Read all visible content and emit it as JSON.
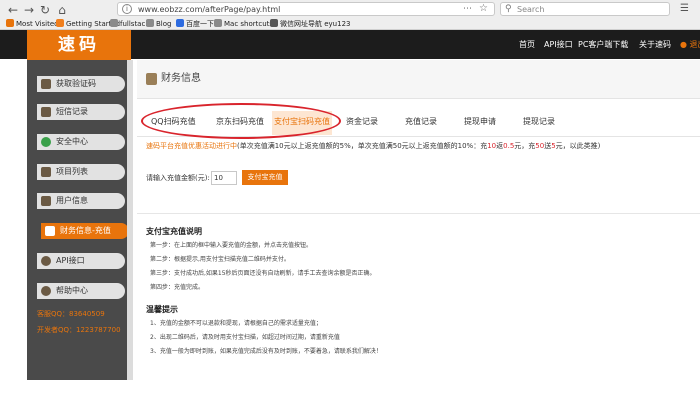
{
  "browser": {
    "url": "www.eobzz.com/afterPage/pay.html",
    "search_placeholder": "Search",
    "bookmarks": [
      "Most Visited",
      "Getting Started",
      "fullstack",
      "Blog",
      "百度一下",
      "Mac shortcuts",
      "微信网址导航 eyu123"
    ]
  },
  "site": {
    "logo": "速码",
    "nav": [
      "首页",
      "API接口",
      "PC客户端下载",
      "关于速码"
    ],
    "exit_label": "退出"
  },
  "sidebar": {
    "items": [
      {
        "label": "获取验证码",
        "icon": "phone-icon"
      },
      {
        "label": "短信记录",
        "icon": "message-icon"
      },
      {
        "label": "安全中心",
        "icon": "shield-icon"
      },
      {
        "label": "项目列表",
        "icon": "list-icon"
      },
      {
        "label": "用户信息",
        "icon": "user-icon"
      },
      {
        "label": "财务信息-充值",
        "icon": "wallet-icon"
      },
      {
        "label": "API接口",
        "icon": "api-icon"
      },
      {
        "label": "帮助中心",
        "icon": "help-icon"
      }
    ],
    "active_index": 5,
    "qq_service": "客服QQ：83640509",
    "qq_dev": "开发者QQ：1223787700"
  },
  "main": {
    "title": "财务信息",
    "tabs": [
      "QQ扫码充值",
      "京东扫码充值",
      "支付宝扫码充值",
      "资金记录",
      "充值记录",
      "提现申请",
      "提现记录"
    ],
    "active_tab": 2,
    "promo": {
      "part1": "速码平台充值优惠活动进行中",
      "part2": "(单次充值满10元以上返充值额的5%，单次充值满50元以上返充值额的10%：充",
      "v1": "10",
      "part3": "返",
      "v2": "0.5",
      "part4": "元，充",
      "v3": "50",
      "part5": "送",
      "v4": "5",
      "part6": "元，以此类推)"
    },
    "amount_label": "请输入充值金额(元):",
    "amount_value": "10",
    "pay_button": "支付宝充值",
    "instructions_title": "支付宝充值说明",
    "steps": [
      "第一步：在上面的框中输入要充值的金额，并点击充值按钮。",
      "第二步：根据提示,用支付宝扫描充值二维码并支付。",
      "第三步：支付成功后,如果15秒后页面还没有自动刷新，请手工去查询余额是否正确。",
      "第四步：充值完成。"
    ],
    "tips_title": "温馨提示",
    "tips": [
      "1、充值的金额不可以退款和提现，请根据自己的需求适量充值；",
      "2、出现二维码后，请及时用支付宝扫描，如超过时间过期，请重新充值",
      "3、充值一般为即时到账，如果充值完成后没有及时到账，不要着急，请联系我们解决！"
    ]
  }
}
